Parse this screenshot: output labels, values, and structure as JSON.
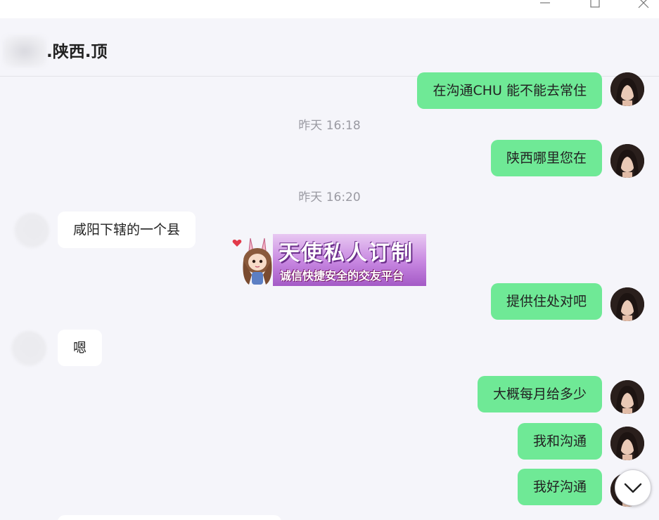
{
  "window": {
    "controls": [
      "minimize-icon",
      "maximize-icon",
      "close-icon"
    ]
  },
  "header": {
    "title": ".陕西.顶"
  },
  "messages": [
    {
      "dir": "out",
      "text": "在沟通CHU 能不能去常住"
    },
    {
      "dir": "time",
      "text": "昨天 16:18"
    },
    {
      "dir": "out",
      "text": "陕西哪里您在"
    },
    {
      "dir": "time",
      "text": "昨天 16:20"
    },
    {
      "dir": "in",
      "text": "咸阳下辖的一个县"
    },
    {
      "dir": "out",
      "text": "提供住处对吧"
    },
    {
      "dir": "in",
      "text": "嗯"
    },
    {
      "dir": "out",
      "text": "大概每月给多少"
    },
    {
      "dir": "out",
      "text": "我和沟通"
    },
    {
      "dir": "out",
      "text": "我好沟通"
    }
  ],
  "banner": {
    "title": "天使私人订制",
    "subtitle": "诚信快捷安全的交友平台"
  },
  "colors": {
    "outgoing_bubble": "#6fe996",
    "incoming_bubble": "#ffffff",
    "background": "#f5f5fa",
    "timestamp": "#9a9aa2"
  },
  "icons": {
    "scroll_down": "chevron-down-icon"
  }
}
